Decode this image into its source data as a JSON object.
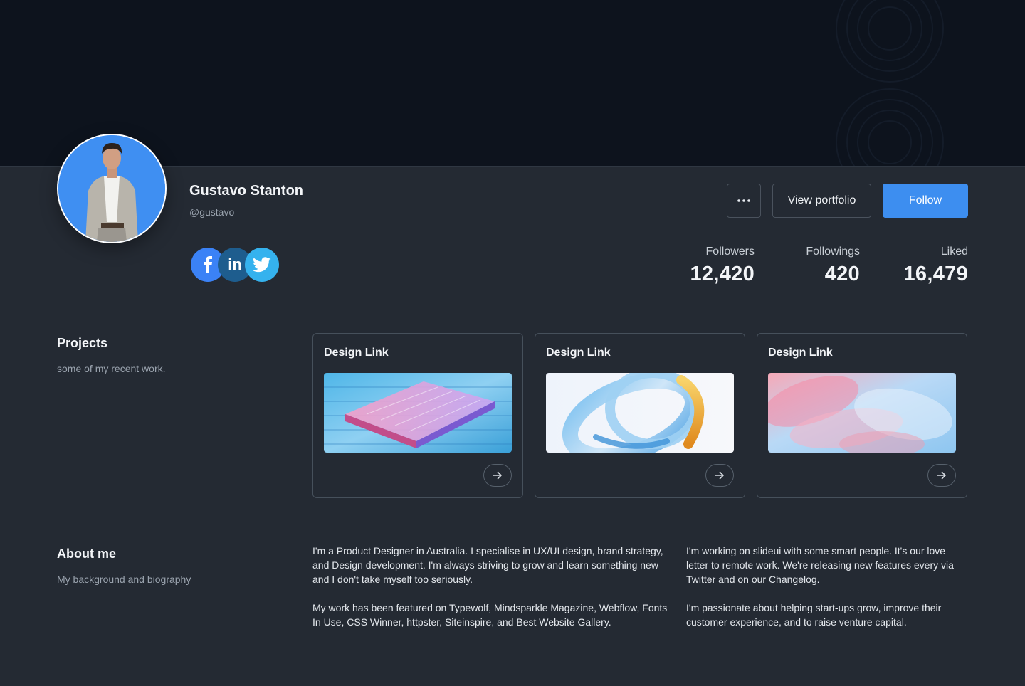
{
  "profile": {
    "name": "Gustavo Stanton",
    "handle": "@gustavo"
  },
  "social_icons": [
    "facebook-icon",
    "linkedin-icon",
    "twitter-icon"
  ],
  "social_labels": {
    "linkedin": "in"
  },
  "actions": {
    "more_icon": "more-horizontal-icon",
    "view_portfolio": "View portfolio",
    "follow": "Follow"
  },
  "stats": [
    {
      "label": "Followers",
      "value": "12,420"
    },
    {
      "label": "Followings",
      "value": "420"
    },
    {
      "label": "Liked",
      "value": "16,479"
    }
  ],
  "projects": {
    "title": "Projects",
    "subtitle": "some of my recent work.",
    "cards": [
      {
        "title": "Design Link",
        "arrow_icon": "arrow-right-icon"
      },
      {
        "title": "Design Link",
        "arrow_icon": "arrow-right-icon"
      },
      {
        "title": "Design Link",
        "arrow_icon": "arrow-right-icon"
      }
    ]
  },
  "about": {
    "title": "About me",
    "subtitle": "My background and biography",
    "col1_p1": "I'm a Product Designer in Australia. I specialise in UX/UI design, brand strategy, and Design development. I'm always striving to grow and learn something new and I don't take myself too seriously.",
    "col1_p2": "My work has been featured on Typewolf, Mindsparkle Magazine, Webflow, Fonts In Use, CSS Winner, httpster, Siteinspire, and Best Website Gallery.",
    "col2_p1": "I'm working on slideui with some smart people. It's our love letter to remote work. We're releasing new features every via Twitter and on our Changelog.",
    "col2_p2": "I'm passionate about helping start-ups grow, improve their customer experience, and to raise venture capital."
  },
  "colors": {
    "background": "#242a33",
    "cover": "#0d131d",
    "accent": "#3d8ef0",
    "facebook": "#3b82f6",
    "linkedin": "#1e5d8e",
    "twitter": "#35b2ee"
  }
}
